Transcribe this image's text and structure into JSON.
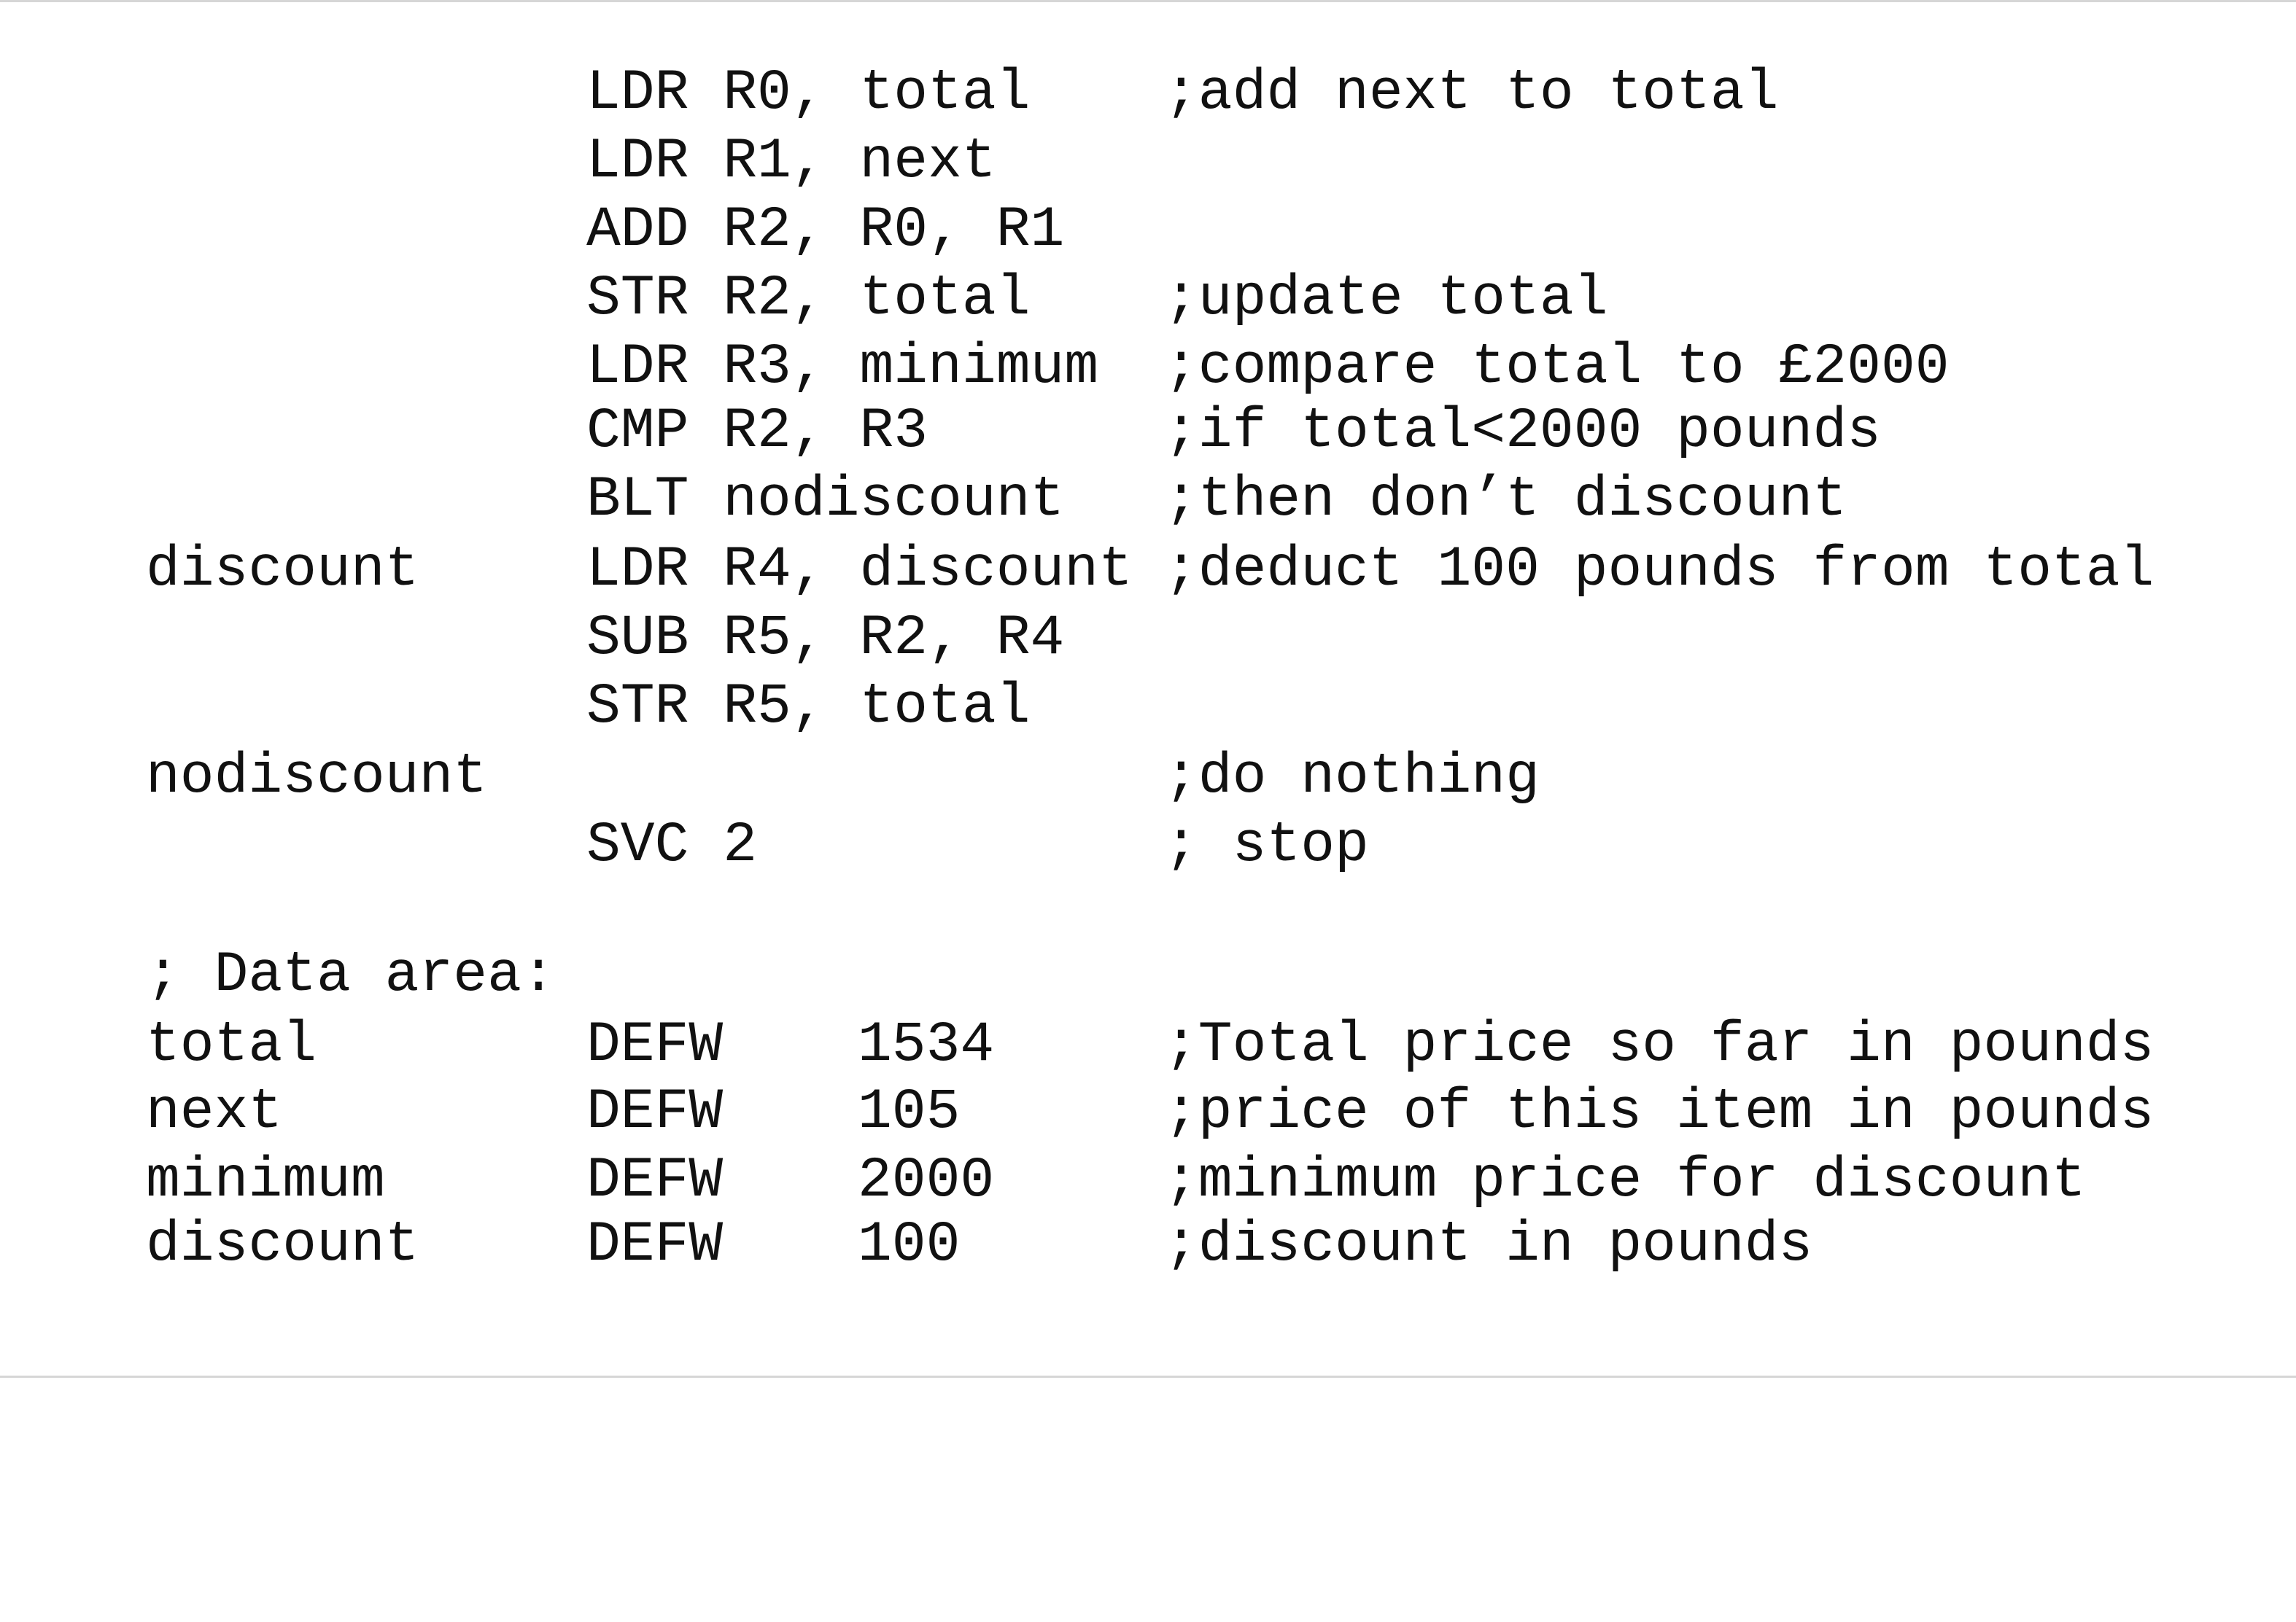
{
  "code_lines": [
    {
      "label": "",
      "instruction": "LDR R0, total",
      "comment": ";add next to total"
    },
    {
      "label": "",
      "instruction": "LDR R1, next",
      "comment": ""
    },
    {
      "label": "",
      "instruction": "ADD R2, R0, R1",
      "comment": ""
    },
    {
      "label": "",
      "instruction": "STR R2, total",
      "comment": ";update total"
    },
    {
      "label": "",
      "instruction": "LDR R3, minimum",
      "comment": ";compare total to £2000"
    },
    {
      "label": "",
      "instruction": "CMP R2, R3",
      "comment": ";if total<2000 pounds"
    },
    {
      "label": "",
      "instruction": "BLT nodiscount",
      "comment": ";then don’t discount"
    },
    {
      "label": "discount",
      "instruction": "LDR R4, discount",
      "comment": ";deduct 100 pounds from total"
    },
    {
      "label": "",
      "instruction": "SUB R5, R2, R4",
      "comment": ""
    },
    {
      "label": "",
      "instruction": "STR R5, total",
      "comment": ""
    },
    {
      "label": "nodiscount",
      "instruction": "",
      "comment": ";do nothing"
    },
    {
      "label": "",
      "instruction": "SVC 2",
      "comment": "; stop"
    }
  ],
  "data_area_header": "; Data area:",
  "data_lines": [
    {
      "label": "total",
      "directive": "DEFW",
      "value": "1534",
      "comment": ";Total price so far in pounds"
    },
    {
      "label": "next",
      "directive": "DEFW",
      "value": "105",
      "comment": ";price of this item in pounds"
    },
    {
      "label": "minimum",
      "directive": "DEFW",
      "value": "2000",
      "comment": ";minimum price for discount"
    },
    {
      "label": "discount",
      "directive": "DEFW",
      "value": "100",
      "comment": ";discount in pounds"
    }
  ]
}
